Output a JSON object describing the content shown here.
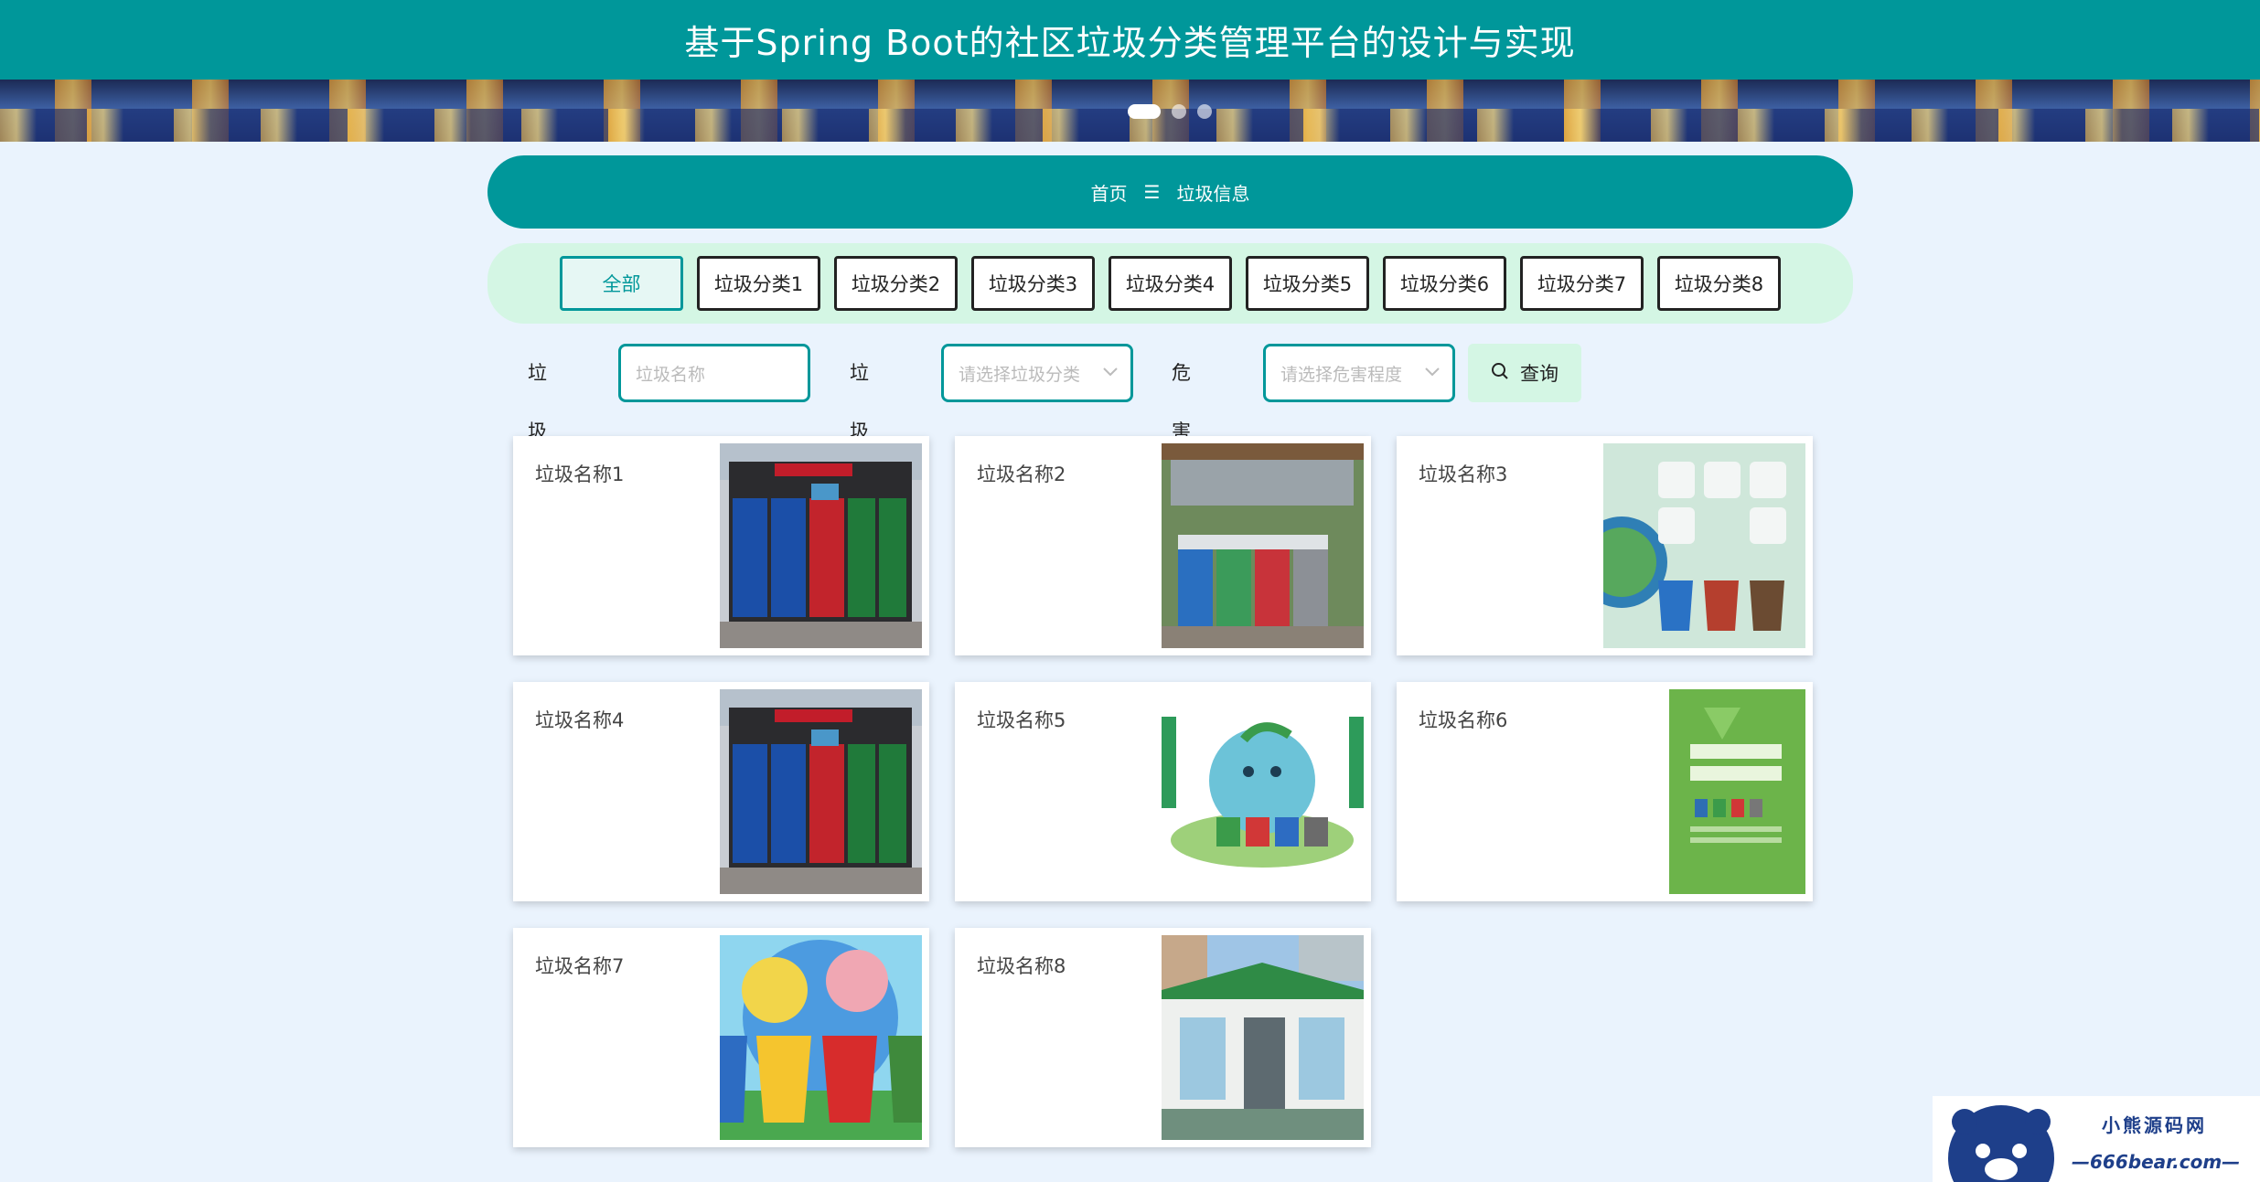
{
  "header": {
    "title": "基于Spring Boot的社区垃圾分类管理平台的设计与实现"
  },
  "carousel": {
    "slide_count": 3,
    "active_index": 0
  },
  "breadcrumb": {
    "home": "首页",
    "separator": "☰",
    "current": "垃圾信息"
  },
  "tabs": [
    {
      "label": "全部",
      "active": true
    },
    {
      "label": "垃圾分类1"
    },
    {
      "label": "垃圾分类2"
    },
    {
      "label": "垃圾分类3"
    },
    {
      "label": "垃圾分类4"
    },
    {
      "label": "垃圾分类5"
    },
    {
      "label": "垃圾分类6"
    },
    {
      "label": "垃圾分类7"
    },
    {
      "label": "垃圾分类8"
    }
  ],
  "search": {
    "name_label": "垃圾名称",
    "name_placeholder": "垃圾名称",
    "category_label": "垃圾分类",
    "category_placeholder": "请选择垃圾分类",
    "hazard_label": "危害程度",
    "hazard_placeholder": "请选择危害程度",
    "query_button": "查询"
  },
  "cards": [
    {
      "name": "垃圾名称1",
      "image": "bins-machine"
    },
    {
      "name": "垃圾名称2",
      "image": "bins-station"
    },
    {
      "name": "垃圾名称3",
      "image": "bins-sorting-poster"
    },
    {
      "name": "垃圾名称4",
      "image": "bins-machine"
    },
    {
      "name": "垃圾名称5",
      "image": "globe-cartoon"
    },
    {
      "name": "垃圾名称6",
      "image": "green-poster"
    },
    {
      "name": "垃圾名称7",
      "image": "colorful-bins"
    },
    {
      "name": "垃圾名称8",
      "image": "kiosk-building"
    }
  ],
  "watermark": {
    "title": "小熊源码网",
    "site": "—666bear.com—"
  },
  "colors": {
    "primary": "#00979a",
    "accent_light": "#d4f6e4",
    "background": "#eaf3fd"
  }
}
